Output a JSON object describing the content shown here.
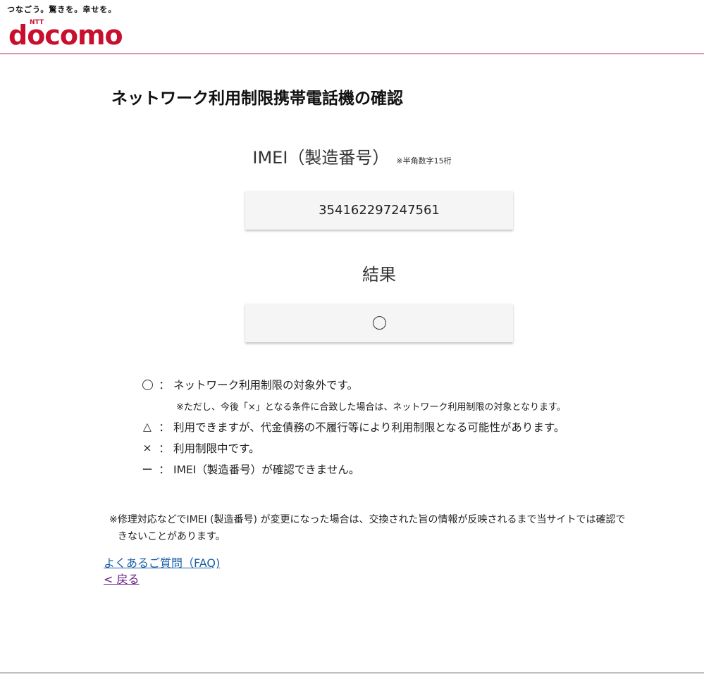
{
  "header": {
    "slogan": "つなごう。驚きを。幸せを。",
    "logo_small": "NTT",
    "logo_main": "docomo",
    "brand_color": "#c8102e"
  },
  "page": {
    "title": "ネットワーク利用制限携帯電話機の確認"
  },
  "imei": {
    "label": "IMEI（製造番号）",
    "note": "※半角数字15桁",
    "value": "354162297247561"
  },
  "result": {
    "label": "結果",
    "symbol_icon": "circle-icon"
  },
  "legend": [
    {
      "symbol": "circle-icon",
      "colon": "：",
      "text": "ネットワーク利用制限の対象外です。",
      "note": "※ただし、今後「×」となる条件に合致した場合は、ネットワーク利用制限の対象となります。"
    },
    {
      "symbol": "△",
      "colon": "：",
      "text": "利用できますが、代金債務の不履行等により利用制限となる可能性があります。"
    },
    {
      "symbol": "×",
      "colon": "：",
      "text": "利用制限中です。"
    },
    {
      "symbol": "ー",
      "colon": "：",
      "text": "IMEI（製造番号）が確認できません。"
    }
  ],
  "footnote": {
    "line1": "※修理対応などでIMEI (製造番号) が変更になった場合は、交換された旨の情報が反映されるまで当サイトでは確認で",
    "line2": "きないことがあります。"
  },
  "links": {
    "faq": "よくあるご質問（FAQ)",
    "back": "< 戻る"
  }
}
